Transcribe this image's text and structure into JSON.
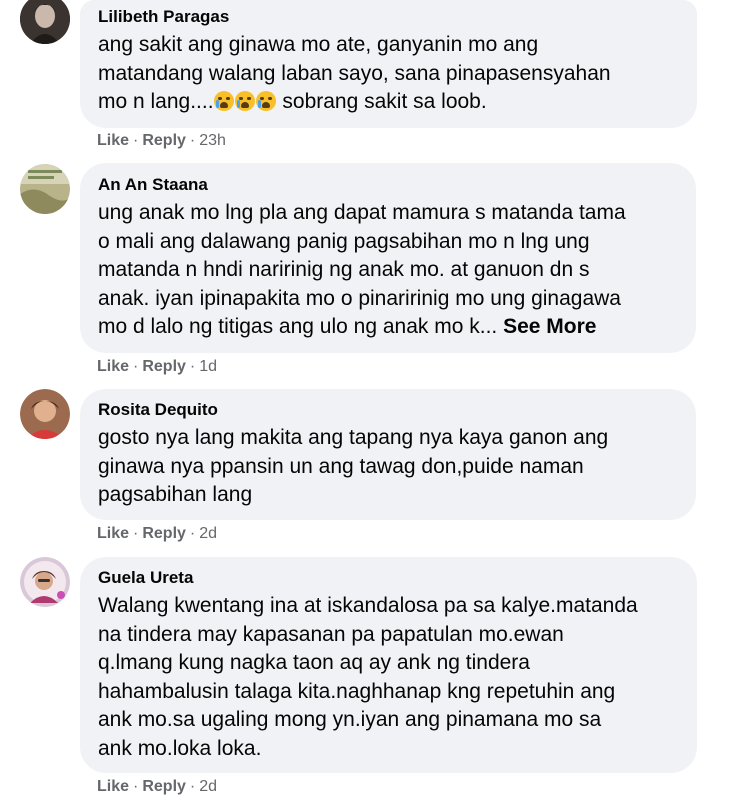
{
  "actions": {
    "like_label": "Like",
    "reply_label": "Reply",
    "separator": "·"
  },
  "see_more_label": "See More",
  "comments": [
    {
      "author": "Lilibeth Paragas",
      "text": "ang sakit ang ginawa mo ate, ganyanin mo ang\nmatandang walang laban sayo, sana pinapasensyahan\nmo n lang....",
      "text_after_emoji": " sobrang sakit sa loob.",
      "emoji": "crying-face-emoji",
      "emoji_count": 3,
      "time": "23h"
    },
    {
      "author": "An An Staana",
      "text": "ung anak mo lng pla ang dapat mamura s matanda tama\no mali ang dalawang panig pagsabihan mo n lng ung\nmatanda n hndi naririnig ng anak mo. at ganuon dn s\nanak. iyan ipinapakita mo o pinaririnig mo ung ginagawa\nmo d lalo ng titigas ang ulo ng anak mo k... ",
      "time": "1d"
    },
    {
      "author": "Rosita Dequito",
      "text": "gosto nya lang makita ang tapang nya kaya ganon ang\nginawa nya ppansin un ang tawag don,puide naman\npagsabihan lang",
      "time": "2d"
    },
    {
      "author": "Guela Ureta",
      "text": "Walang kwentang ina at iskandalosa pa sa kalye.matanda\nna tindera may kapasanan pa papatulan mo.ewan\nq.lmang kung nagka taon aq ay ank ng tindera\nhahambalusin talaga kita.naghhanap kng repetuhin ang\nank mo.sa ugaling mong yn.iyan ang pinamana mo sa\nank mo.loka loka.",
      "time": "2d"
    }
  ],
  "colors": {
    "bubble": "#f0f2f5",
    "name": "#050505",
    "meta": "#65676b"
  }
}
